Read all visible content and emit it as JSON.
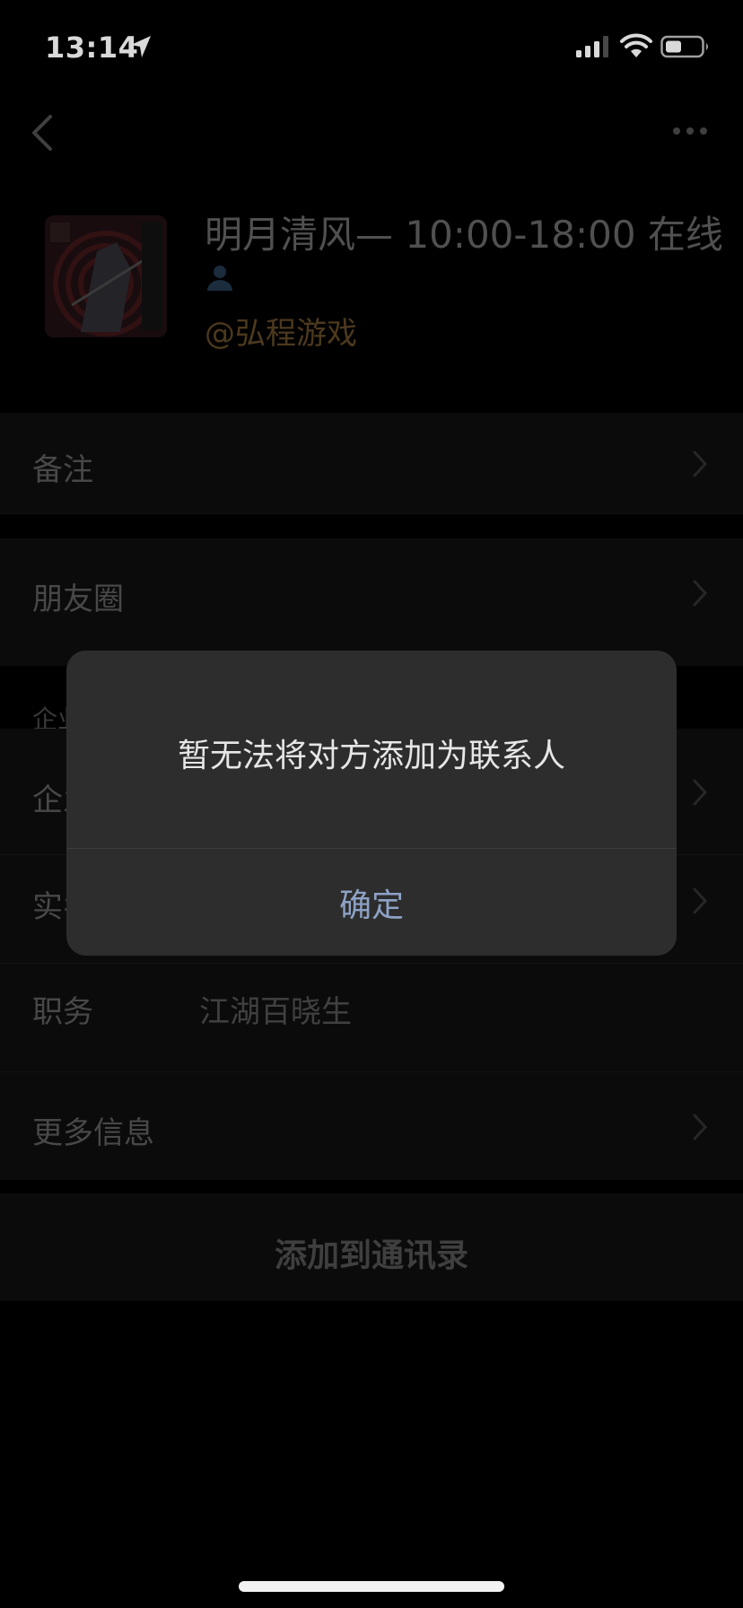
{
  "status_bar": {
    "time": "13:14"
  },
  "profile": {
    "name": "明月清风— 10:00-18:00 在线",
    "company": "@弘程游戏"
  },
  "rows": {
    "remark": {
      "label": "备注"
    },
    "moments": {
      "label": "朋友圈"
    },
    "enterprise_section": {
      "label": "企业"
    },
    "enterprise": {
      "label": "企业"
    },
    "real_name": {
      "label": "实名"
    },
    "position": {
      "label": "职务",
      "value": "江湖百晓生"
    },
    "more_info": {
      "label": "更多信息"
    }
  },
  "add_button": {
    "label": "添加到通讯录"
  },
  "dialog": {
    "message": "暂无法将对方添加为联系人",
    "confirm_label": "确定"
  },
  "colors": {
    "background": "#000000",
    "dialog_bg": "#2d2d2d",
    "dialog_accent": "#8ea2c6",
    "company_text": "#5a4424"
  }
}
